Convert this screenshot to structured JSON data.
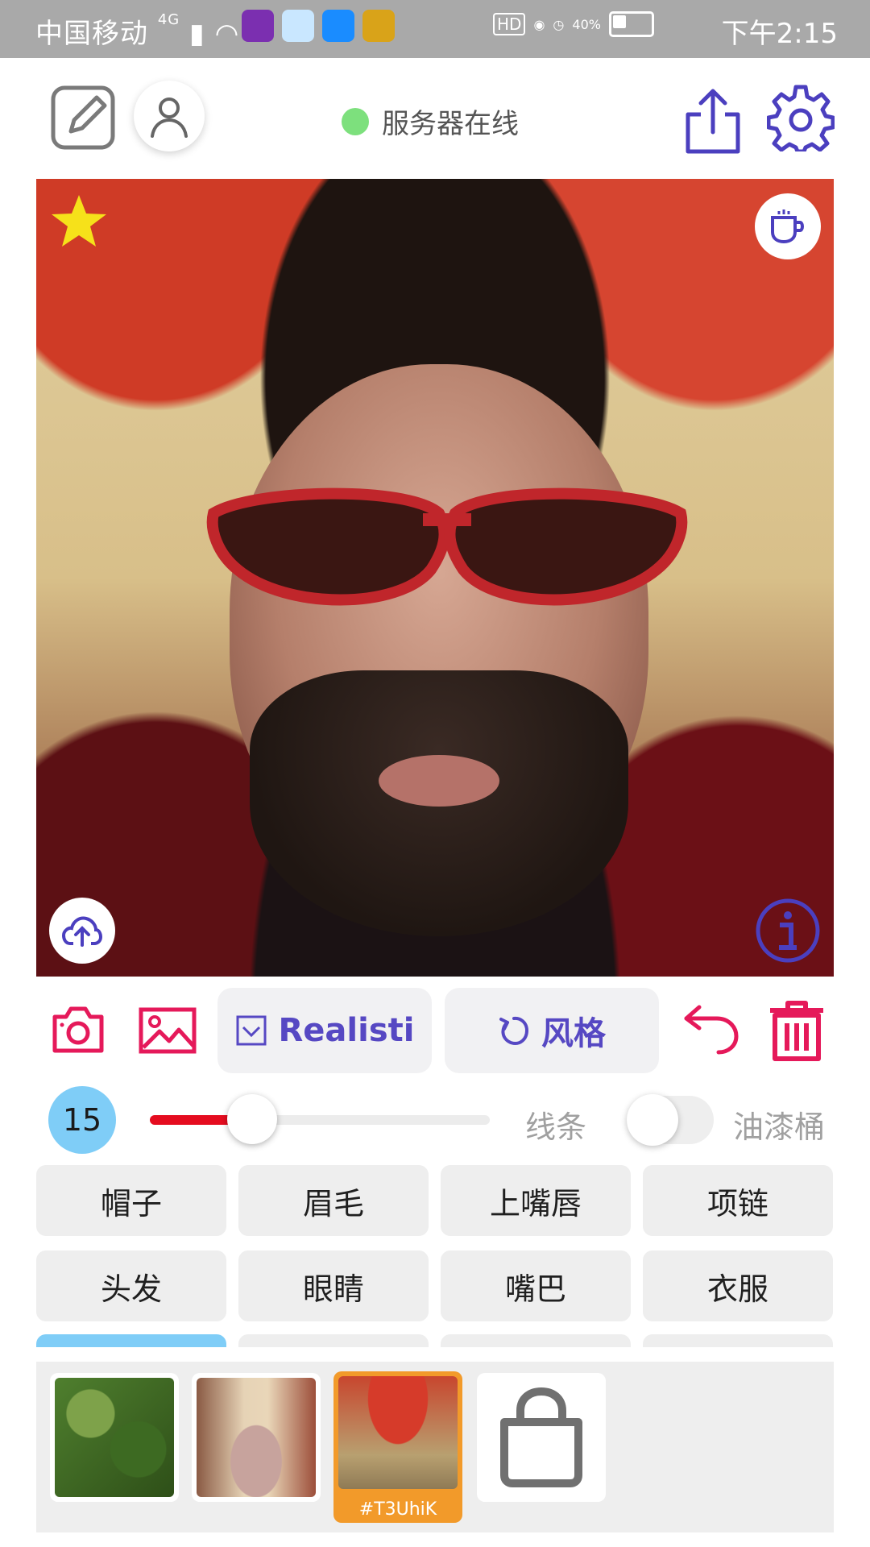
{
  "status_bar": {
    "carrier": "中国移动",
    "network": "4G",
    "battery": "40%",
    "time": "下午2:15"
  },
  "header": {
    "server_status": "服务器在线",
    "server_status_color": "#7de07d"
  },
  "toolbar": {
    "realistic_label": "Realisti",
    "style_label": "风格"
  },
  "brush": {
    "size": "15",
    "slider_fraction": 0.3,
    "line_label": "线条",
    "bucket_label": "油漆桶",
    "bucket_toggle_on": false
  },
  "categories": [
    {
      "label": "帽子"
    },
    {
      "label": "眉毛"
    },
    {
      "label": "上嘴唇"
    },
    {
      "label": "项链"
    },
    {
      "label": "头发"
    },
    {
      "label": "眼睛"
    },
    {
      "label": "嘴巴"
    },
    {
      "label": "衣服"
    }
  ],
  "styles": {
    "selected_tag": "#T3UhiK"
  },
  "icons": [
    "edit-icon",
    "user-icon",
    "share-icon",
    "gear-icon",
    "star-icon",
    "coffee-icon",
    "cloud-upload-icon",
    "info-icon",
    "camera-icon",
    "image-icon",
    "checkbox-icon",
    "rotate-icon",
    "undo-icon",
    "trash-icon",
    "shopping-bag-icon"
  ],
  "colors": {
    "accent": "#5648c3",
    "danger": "#e5195a",
    "slider_fill": "#e50c1f",
    "size_badge": "#7fcdf7",
    "selected_style": "#f29a2a"
  }
}
